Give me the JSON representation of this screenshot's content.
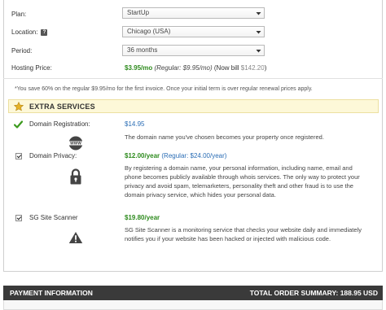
{
  "order_form": {
    "plan": {
      "label": "Plan:",
      "value": "StartUp"
    },
    "location": {
      "label": "Location:",
      "help_icon": "?",
      "value": "Chicago (USA)"
    },
    "period": {
      "label": "Period:",
      "value": "36 months"
    },
    "hosting_price": {
      "label": "Hosting Price:",
      "price": "$3.95/mo",
      "regular": "(Regular: $9.95/mo)",
      "now_bill_prefix": "(Now bill",
      "now_bill_amount": "$142.20",
      "now_bill_suffix": ")"
    },
    "savings_note": "*You save 60% on the regular $9.95/mo for the first invoice. Once your initial term is over regular renewal prices apply."
  },
  "extra_services": {
    "title": "EXTRA SERVICES",
    "items": [
      {
        "label": "Domain Registration:",
        "checked": true,
        "control": "checkmark",
        "icon": "www-globe-icon",
        "price": "$14.95",
        "description": "The domain name you've chosen becomes your property once registered."
      },
      {
        "label": "Domain Privacy:",
        "checked": true,
        "control": "checkbox",
        "icon": "lock-icon",
        "price": "$12.00/year",
        "regular": "(Regular: $24.00/year)",
        "description": "By registering a domain name, your personal information, including name, email and phone becomes publicly available through whois services. The only way to protect your privacy and avoid spam, telemarketers, personality theft and other fraud is to use the domain privacy service, which hides your personal data."
      },
      {
        "label": "SG Site Scanner",
        "checked": true,
        "control": "checkbox",
        "icon": "warning-icon",
        "price": "$19.80/year",
        "description": "SG Site Scanner is a monitoring service that checks your website daily and immediately notifies you if your website has been hacked or injected with malicious code."
      }
    ]
  },
  "footer": {
    "left": "PAYMENT INFORMATION",
    "right": "TOTAL ORDER SUMMARY: 188.95 USD"
  },
  "colors": {
    "accent_green": "#2e8b1e",
    "link_blue": "#2a6db5",
    "extra_bar_bg": "#fdf8d8",
    "footer_bg": "#3a3a3a"
  }
}
